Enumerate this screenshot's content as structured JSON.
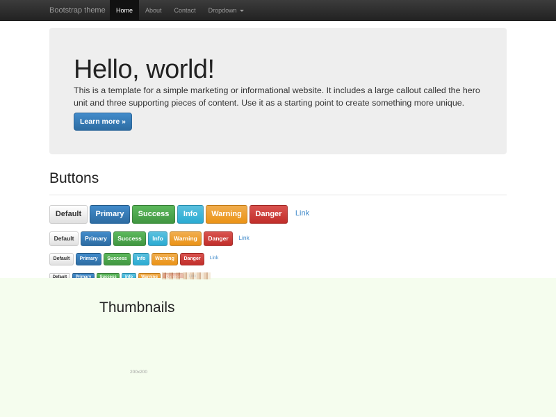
{
  "navbar": {
    "brand": "Bootstrap theme",
    "items": [
      {
        "label": "Home",
        "active": true
      },
      {
        "label": "About"
      },
      {
        "label": "Contact"
      },
      {
        "label": "Dropdown",
        "dropdown": true
      }
    ]
  },
  "hero": {
    "title": "Hello, world!",
    "text": "This is a template for a simple marketing or informational website. It includes a large callout called the hero unit and three supporting pieces of content. Use it as a starting point to create something more unique.",
    "button": "Learn more »"
  },
  "buttons_section": {
    "title": "Buttons",
    "labels": {
      "default": "Default",
      "primary": "Primary",
      "success": "Success",
      "info": "Info",
      "warning": "Warning",
      "danger": "Danger",
      "link": "Link"
    }
  },
  "thumbnails": {
    "title": "Thumbnails",
    "caption": "200x200"
  },
  "colors": {
    "primary": "#428bca",
    "success": "#5cb85c",
    "info": "#5bc0de",
    "warning": "#f0ad4e",
    "danger": "#d9534f",
    "band": "#f5fdee"
  }
}
